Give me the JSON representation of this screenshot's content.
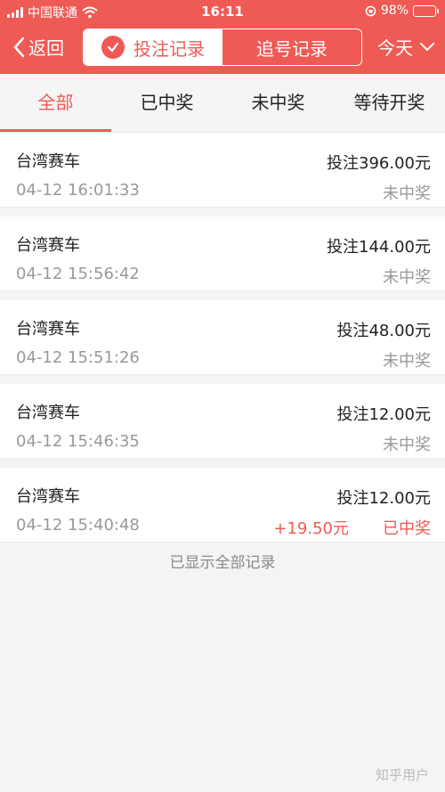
{
  "status_bar": {
    "carrier": "中国联通",
    "time": "16:11",
    "battery": "98%"
  },
  "nav": {
    "back_label": "返回",
    "segments": [
      "投注记录",
      "追号记录"
    ],
    "filter_label": "今天"
  },
  "tabs": [
    "全部",
    "已中奖",
    "未中奖",
    "等待开奖"
  ],
  "records": [
    {
      "name": "台湾赛车",
      "amount": "投注396.00元",
      "time": "04-12 16:01:33",
      "result": "未中奖",
      "gain": ""
    },
    {
      "name": "台湾赛车",
      "amount": "投注144.00元",
      "time": "04-12 15:56:42",
      "result": "未中奖",
      "gain": ""
    },
    {
      "name": "台湾赛车",
      "amount": "投注48.00元",
      "time": "04-12 15:51:26",
      "result": "未中奖",
      "gain": ""
    },
    {
      "name": "台湾赛车",
      "amount": "投注12.00元",
      "time": "04-12 15:46:35",
      "result": "未中奖",
      "gain": ""
    },
    {
      "name": "台湾赛车",
      "amount": "投注12.00元",
      "time": "04-12 15:40:48",
      "result": "已中奖",
      "gain": "+19.50元"
    }
  ],
  "footer_text": "已显示全部记录",
  "watermark": "知乎用户",
  "colors": {
    "accent": "#ef5a55",
    "muted": "#999999",
    "background": "#f4f4f4"
  }
}
